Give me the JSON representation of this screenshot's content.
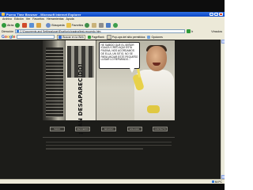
{
  "window": {
    "title": "Pueno Time Browser - Microsoft Internet Explorer"
  },
  "menu": [
    "Archivo",
    "Edición",
    "Ver",
    "Favoritos",
    "Herramientas",
    "Ayuda"
  ],
  "toolbar": {
    "back_label": "Atrás",
    "search_label": "Búsqueda",
    "favorites_label": "Favoritos"
  },
  "address": {
    "label": "Dirección",
    "url": "C:\\Documents and Settings\\user\\Escritorio\\pagina\\test-recuerdo.htm",
    "go_label": "Ir",
    "links_label": "Vínculos"
  },
  "google": {
    "logo": [
      "G",
      "o",
      "o",
      "g",
      "l",
      "e"
    ],
    "search_web": "Buscar en la Web",
    "pagerank": "PageRank",
    "popups": "Pop-ups del sitio permitidos",
    "options": "Opciones"
  },
  "flash": {
    "poster_title": "¡HAN DESAPARECIDO!",
    "speech": "He sabido que el señor Iguazú creó aquí esta página, nos acordamos de ella, un sitio, no se para vaciar este pequeño lugar lo reparado...",
    "nav_buttons": [
      "INICIO",
      "RECUERDO",
      "ARCHIVO",
      "ENLACES",
      "CONTACTO"
    ]
  },
  "status": {
    "left": "",
    "zone": "Mi PC"
  },
  "colors": {
    "titlebar": "#0a46c8",
    "page_bg": "#1c1c19",
    "glove": "#e8d14a"
  }
}
